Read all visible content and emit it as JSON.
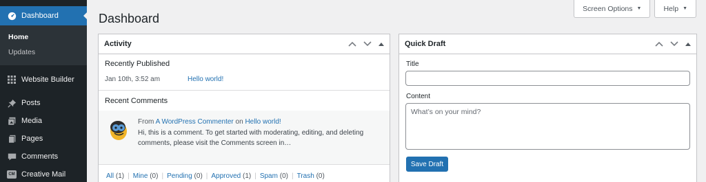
{
  "sidebar": {
    "dashboard_label": "Dashboard",
    "submenu": [
      "Home",
      "Updates"
    ],
    "items": [
      {
        "label": "Website Builder",
        "icon": "grid-icon"
      },
      {
        "label": "Posts",
        "icon": "pushpin-icon"
      },
      {
        "label": "Media",
        "icon": "media-icon"
      },
      {
        "label": "Pages",
        "icon": "pages-icon"
      },
      {
        "label": "Comments",
        "icon": "comment-icon"
      },
      {
        "label": "Creative Mail",
        "icon": "cm-icon",
        "badge": "CM"
      }
    ],
    "active_color": "#2271b1"
  },
  "header": {
    "title": "Dashboard",
    "screen_options": "Screen Options",
    "help": "Help"
  },
  "activity": {
    "title": "Activity",
    "recently_published_title": "Recently Published",
    "published": {
      "date": "Jan 10th, 3:52 am",
      "post": "Hello world!"
    },
    "recent_comments_title": "Recent Comments",
    "comment": {
      "from": "From",
      "author": "A WordPress Commenter",
      "on": "on",
      "post": "Hello world!",
      "text": "Hi, this is a comment. To get started with moderating, editing, and deleting comments, please visit the Comments screen in…"
    },
    "filters": [
      {
        "label": "All",
        "count": "(1)"
      },
      {
        "label": "Mine",
        "count": "(0)"
      },
      {
        "label": "Pending",
        "count": "(0)"
      },
      {
        "label": "Approved",
        "count": "(1)"
      },
      {
        "label": "Spam",
        "count": "(0)"
      },
      {
        "label": "Trash",
        "count": "(0)"
      }
    ]
  },
  "quick_draft": {
    "title": "Quick Draft",
    "title_label": "Title",
    "title_value": "",
    "content_label": "Content",
    "content_placeholder": "What’s on your mind?",
    "save_label": "Save Draft"
  }
}
